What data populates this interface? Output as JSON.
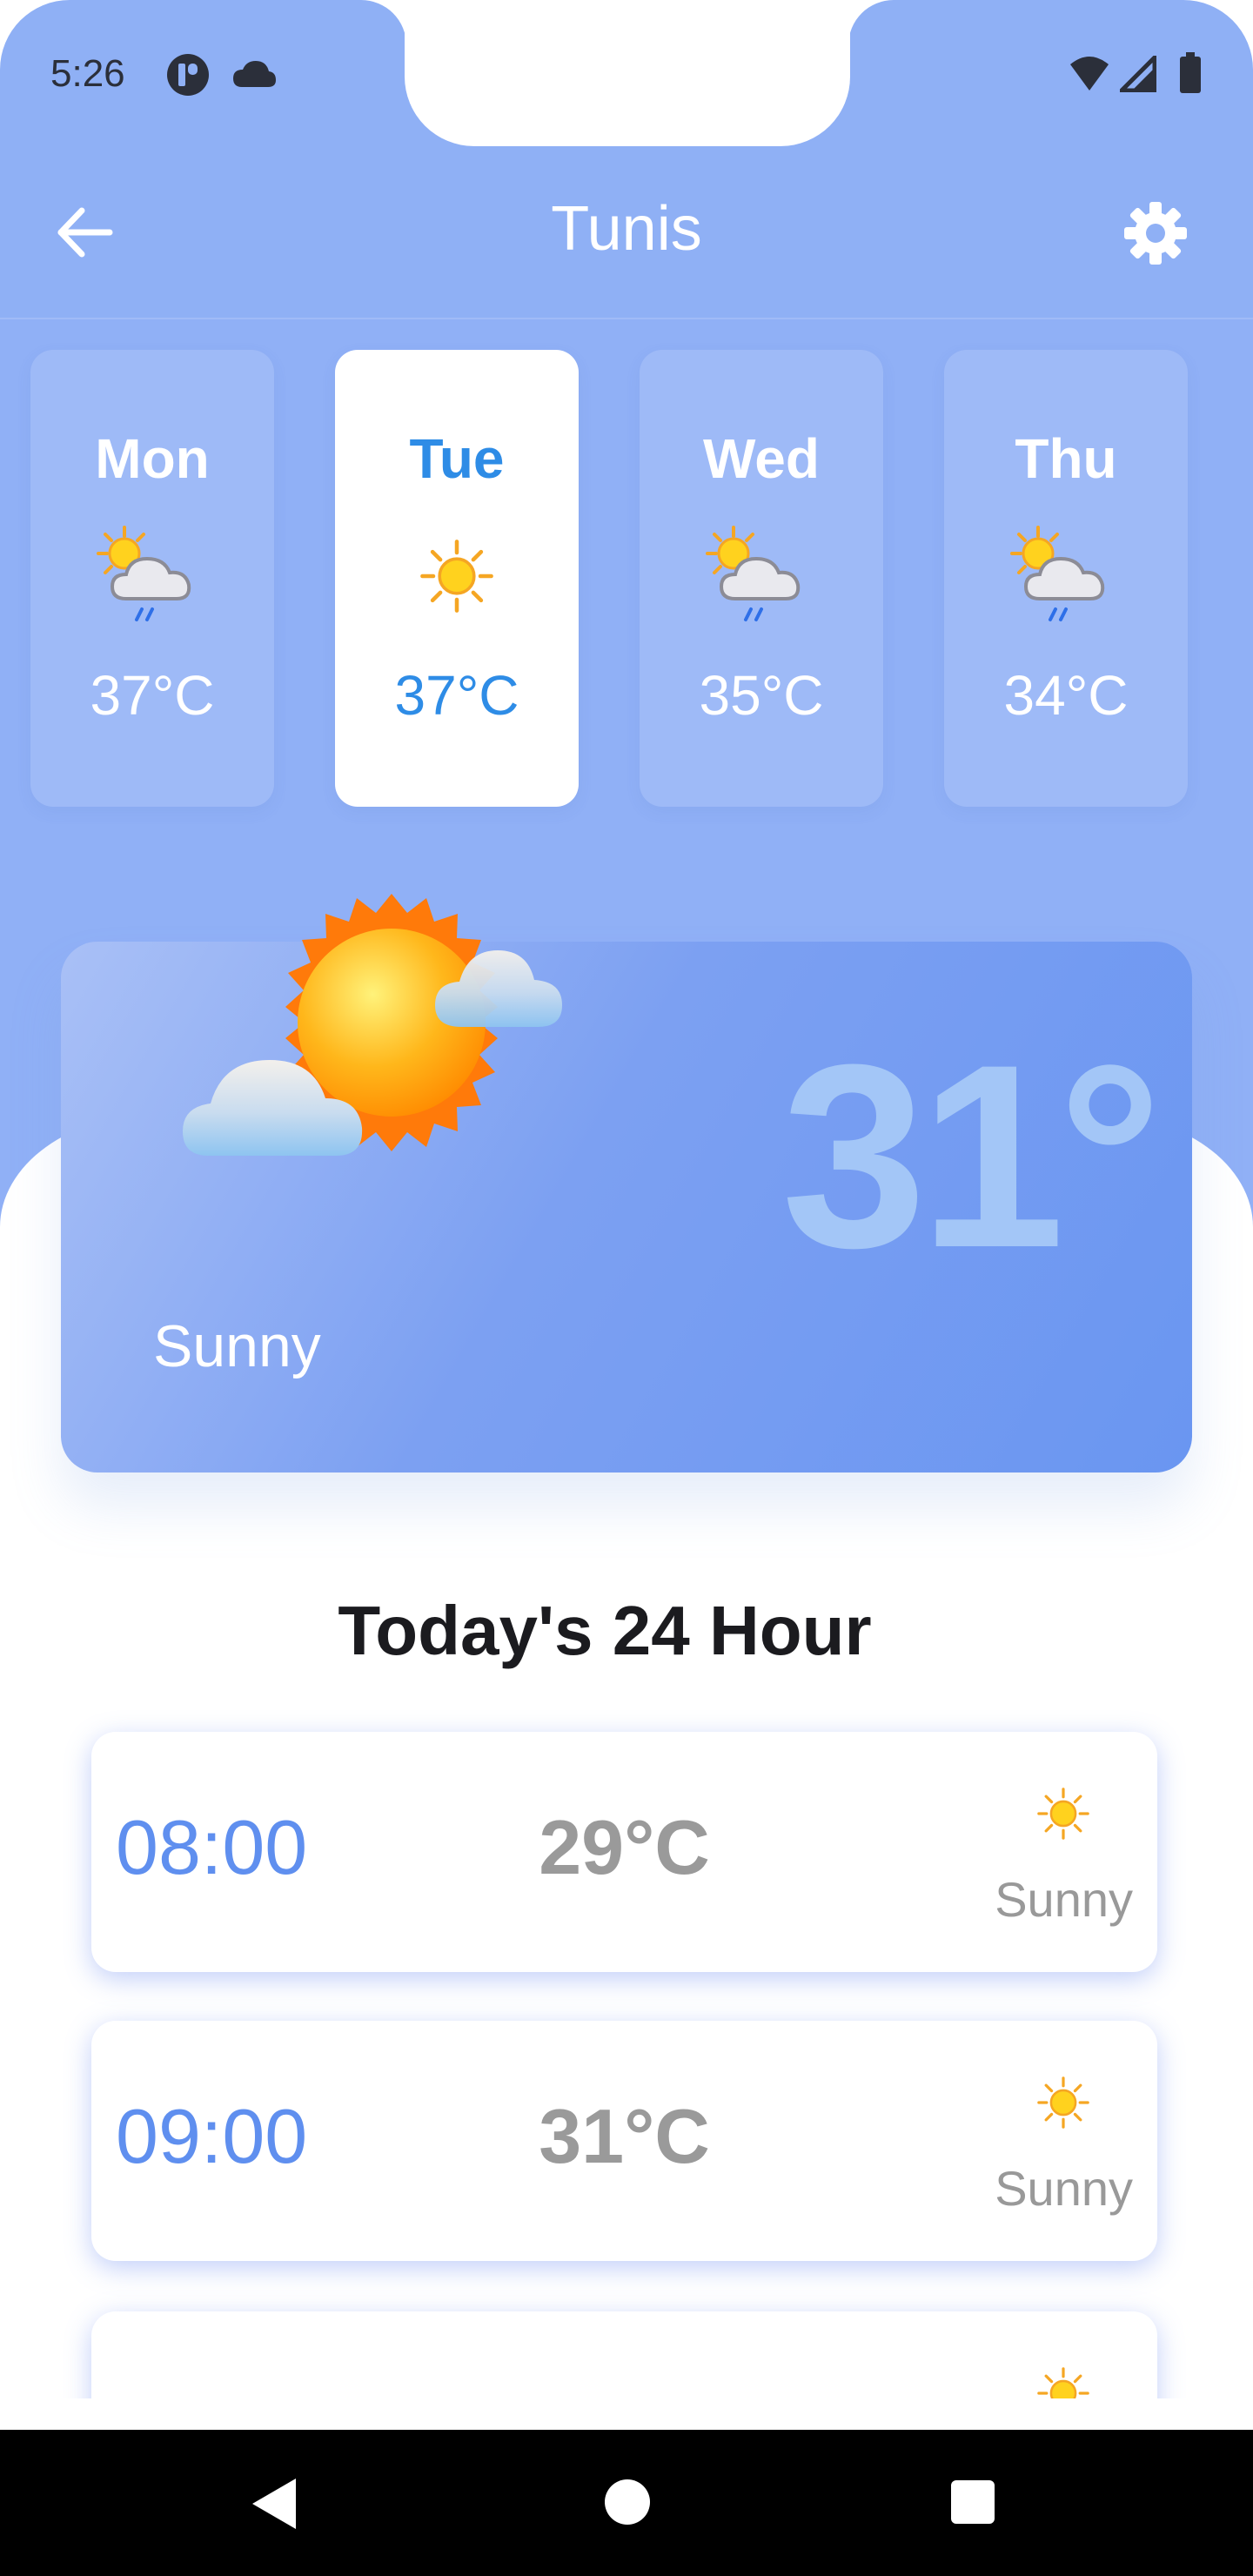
{
  "status_bar": {
    "time": "5:26"
  },
  "app_bar": {
    "title": "Tunis"
  },
  "days": [
    {
      "name": "Mon",
      "temp": "37°C",
      "icon": "sun-cloud-rain-icon",
      "selected": false
    },
    {
      "name": "Tue",
      "temp": "37°C",
      "icon": "sun-icon",
      "selected": true
    },
    {
      "name": "Wed",
      "temp": "35°C",
      "icon": "sun-cloud-rain-icon",
      "selected": false
    },
    {
      "name": "Thu",
      "temp": "34°C",
      "icon": "sun-cloud-rain-icon",
      "selected": false
    }
  ],
  "current": {
    "temp": "31°",
    "condition": "Sunny",
    "icon": "sun-clouds-icon"
  },
  "hourly": {
    "title": "Today's 24 Hour",
    "items": [
      {
        "time": "08:00",
        "temp": "29°C",
        "condition": "Sunny",
        "icon": "sun-icon"
      },
      {
        "time": "09:00",
        "temp": "31°C",
        "condition": "Sunny",
        "icon": "sun-icon"
      },
      {
        "time": "",
        "temp": "",
        "condition": "",
        "icon": "sun-icon"
      }
    ]
  },
  "colors": {
    "header_bg": "#8FB0F5",
    "accent": "#2E8CE6",
    "time_blue": "#5F8FEF",
    "hero_temp": "#A3C6F7"
  }
}
